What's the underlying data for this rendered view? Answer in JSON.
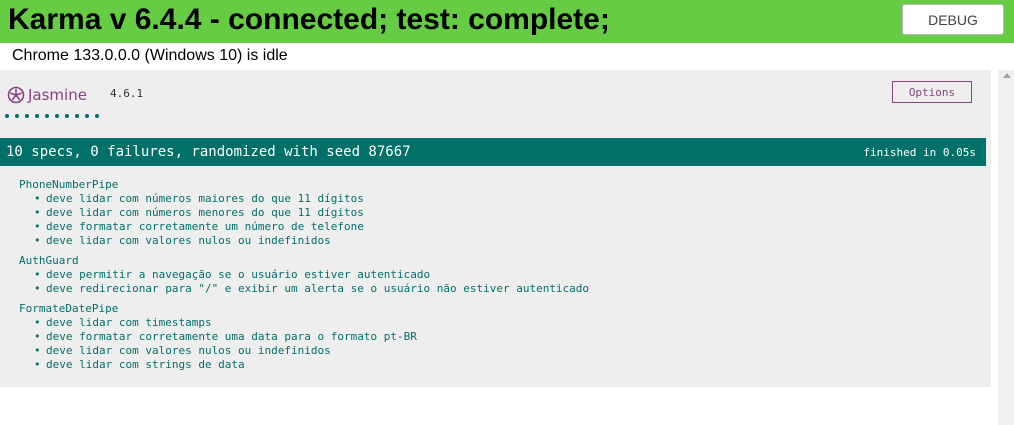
{
  "karma": {
    "title": "Karma v 6.4.4 - connected; test: complete;",
    "debug_label": "DEBUG",
    "browser_status": "Chrome 133.0.0.0 (Windows 10) is idle"
  },
  "jasmine": {
    "logo_text": "Jasmine",
    "version": "4.6.1",
    "options_label": "Options",
    "spec_count": 10,
    "summary": "10 specs, 0 failures, randomized with seed 87667",
    "duration": "finished in 0.05s",
    "suites": [
      {
        "name": "PhoneNumberPipe",
        "specs": [
          "deve lidar com números maiores do que 11 dígitos",
          "deve lidar com números menores do que 11 dígitos",
          "deve formatar corretamente um número de telefone",
          "deve lidar com valores nulos ou indefinidos"
        ]
      },
      {
        "name": "AuthGuard",
        "specs": [
          "deve permitir a navegação se o usuário estiver autenticado",
          "deve redirecionar para \"/\" e exibir um alerta se o usuário não estiver autenticado"
        ]
      },
      {
        "name": "FormateDatePipe",
        "specs": [
          "deve lidar com timestamps",
          "deve formatar corretamente uma data para o formato pt-BR",
          "deve lidar com valores nulos ou indefinidos",
          "deve lidar com strings de data"
        ]
      }
    ]
  },
  "colors": {
    "banner": "#66cc44",
    "jasmine_teal": "#007069",
    "jasmine_purple": "#8a4182",
    "reporter_bg": "#eeeeee"
  },
  "icons": {
    "jasmine_logo": "jasmine-flower-icon"
  }
}
